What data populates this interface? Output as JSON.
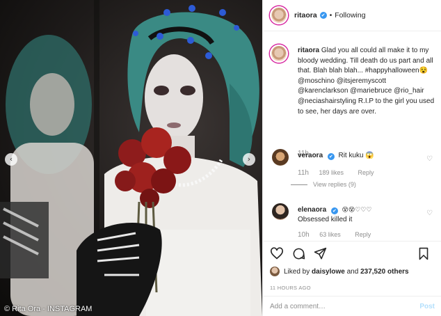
{
  "photo": {
    "credit": "© Rita Ora - INSTAGRAM",
    "nav_prev_glyph": "‹",
    "nav_next_glyph": "›"
  },
  "header": {
    "username": "ritaora",
    "verified_glyph": "✔",
    "separator": "•",
    "follow_state": "Following"
  },
  "caption": {
    "username": "ritaora",
    "text": "Glad you all could all make it to my bloody wedding. Till death do us part and all that. Blah blah blah... #happyhalloween😵 @moschino @itsjeremyscott @karenclarkson @mariebruce @rio_hair @neciashairstyling R.I.P to the girl you used to see, her days are over.",
    "time": "11h"
  },
  "comments": [
    {
      "username": "veraora",
      "text": "Rit kuku 😱",
      "time": "11h",
      "likes": "189 likes",
      "reply": "Reply",
      "view_replies": "View replies (9)"
    },
    {
      "username": "elenaora",
      "text": "😵😵♡♡♡",
      "text2": "Obsessed killed it",
      "time": "10h",
      "likes": "63 likes",
      "reply": "Reply"
    }
  ],
  "actions": {
    "liked_by_prefix": "Liked by ",
    "liked_by_user": "daisylowe",
    "liked_by_suffix": " and ",
    "liked_count": "237,520 others",
    "posted": "11 HOURS AGO"
  },
  "add_comment": {
    "placeholder": "Add a comment…",
    "post_label": "Post"
  },
  "colors": {
    "link": "#003569",
    "muted": "#8e8e8e",
    "verified": "#3897f0",
    "post_disabled": "#b2dffc"
  }
}
